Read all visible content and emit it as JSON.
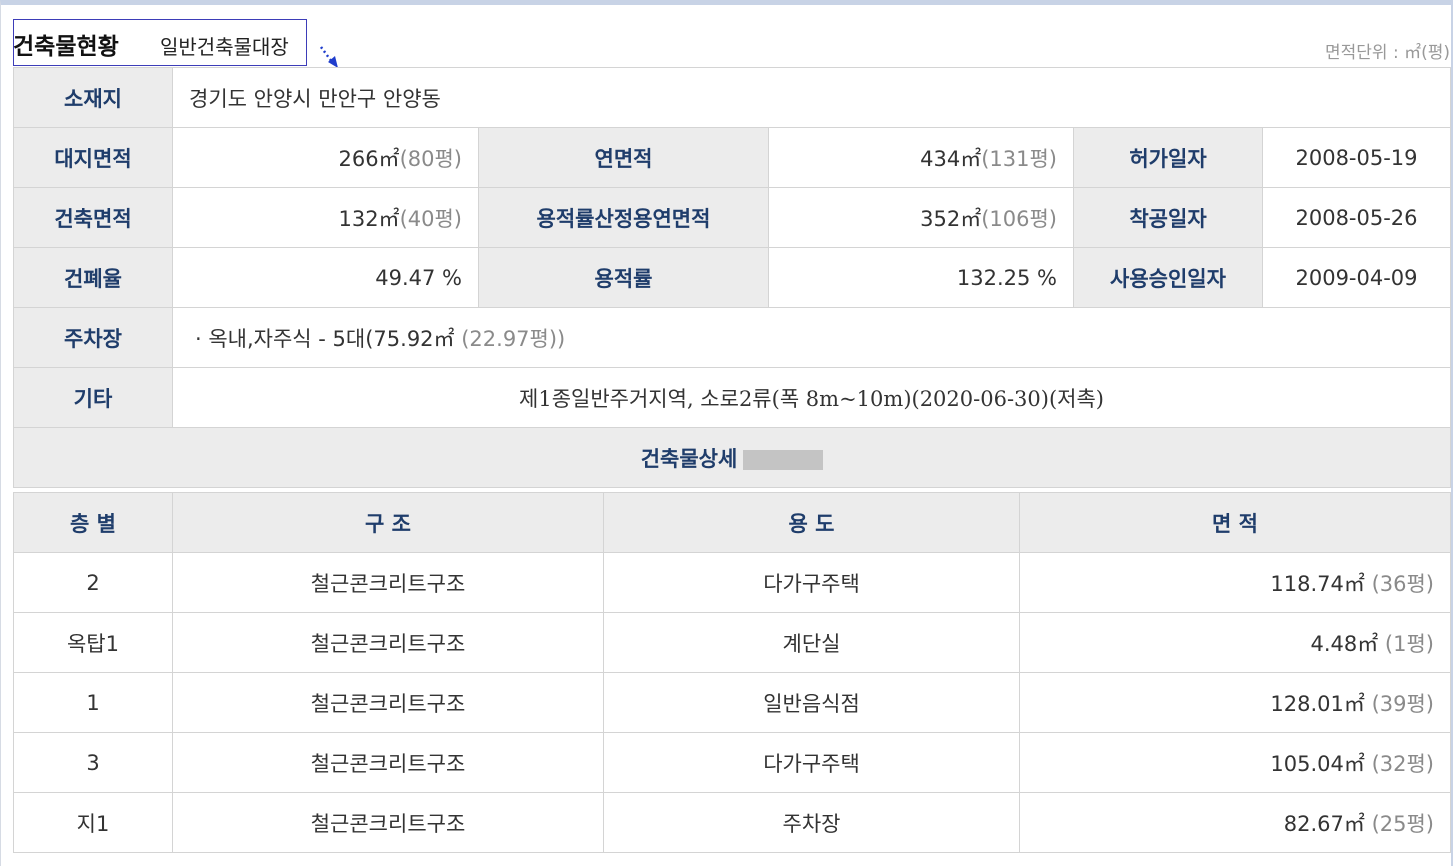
{
  "header": {
    "title": "건축물현황",
    "subtitle": "일반건축물대장",
    "unit_note": "면적단위 : ㎡(평)"
  },
  "summary": {
    "location_label": "소재지",
    "location_value": "경기도 안양시 만안구 안양동",
    "land_area_label": "대지면적",
    "land_area_m2": "266㎡",
    "land_area_py": "(80평)",
    "total_floor_area_label": "연면적",
    "total_floor_area_m2": "434㎡",
    "total_floor_area_py": "(131평)",
    "permit_date_label": "허가일자",
    "permit_date_value": "2008-05-19",
    "building_area_label": "건축면적",
    "building_area_m2": "132㎡",
    "building_area_py": "(40평)",
    "far_floor_area_label": "용적률산정용연면적",
    "far_floor_area_m2": "352㎡",
    "far_floor_area_py": "(106평)",
    "start_date_label": "착공일자",
    "start_date_value": "2008-05-26",
    "bcr_label": "건폐율",
    "bcr_value": "49.47 %",
    "far_label": "용적률",
    "far_value": "132.25 %",
    "approval_date_label": "사용승인일자",
    "approval_date_value": "2009-04-09",
    "parking_label": "주차장",
    "parking_value": "· 옥내,자주식 - 5대(75.92㎡",
    "parking_py": "(22.97평))",
    "etc_label": "기타",
    "etc_value": "제1종일반주거지역, 소로2류(폭 8m~10m)(2020-06-30)(저촉)"
  },
  "detail": {
    "section_title": "건축물상세",
    "columns": [
      "층 별",
      "구  조",
      "용  도",
      "면 적"
    ],
    "rows": [
      {
        "floor": "2",
        "structure": "철근콘크리트구조",
        "use": "다가구주택",
        "area": "118.74㎡",
        "area_py": "(36평)"
      },
      {
        "floor": "옥탑1",
        "structure": "철근콘크리트구조",
        "use": "계단실",
        "area": "4.48㎡",
        "area_py": "(1평)"
      },
      {
        "floor": "1",
        "structure": "철근콘크리트구조",
        "use": "일반음식점",
        "area": "128.01㎡",
        "area_py": "(39평)"
      },
      {
        "floor": "3",
        "structure": "철근콘크리트구조",
        "use": "다가구주택",
        "area": "105.04㎡",
        "area_py": "(32평)"
      },
      {
        "floor": "지1",
        "structure": "철근콘크리트구조",
        "use": "주차장",
        "area": "82.67㎡",
        "area_py": "(25평)"
      }
    ]
  }
}
